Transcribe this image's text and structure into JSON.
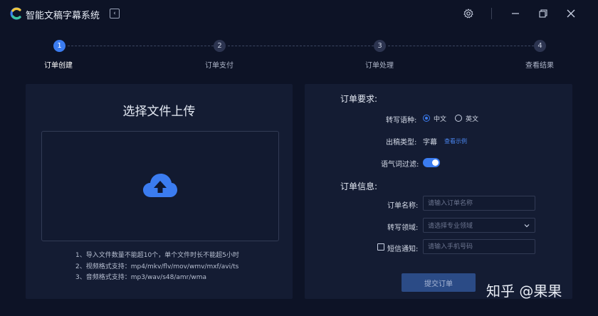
{
  "app": {
    "title": "智能文稿字幕系统",
    "collapse_icon": "‹"
  },
  "steps": [
    {
      "number": "1",
      "label": "订单创建",
      "active": true
    },
    {
      "number": "2",
      "label": "订单支付",
      "active": false
    },
    {
      "number": "3",
      "label": "订单处理",
      "active": false
    },
    {
      "number": "4",
      "label": "查看结果",
      "active": false
    }
  ],
  "upload": {
    "title": "选择文件上传",
    "notes": [
      "1、导入文件数量不能超10个，单个文件时长不能超5小时",
      "2、视频格式支持：mp4/mkv/flv/mov/wmv/mxf/avi/ts",
      "3、音频格式支持：mp3/wav/s48/amr/wma"
    ]
  },
  "requirements": {
    "section_title": "订单要求:",
    "language_label": "转写语种:",
    "language_options": [
      "中文",
      "英文"
    ],
    "output_type_label": "出稿类型:",
    "output_type_value": "字幕",
    "view_example_link": "查看示例",
    "filter_label": "语气词过滤:",
    "filter_on": true
  },
  "info": {
    "section_title": "订单信息:",
    "name_label": "订单名称:",
    "name_placeholder": "请输入订单名称",
    "domain_label": "转写领域:",
    "domain_placeholder": "请选择专业领域",
    "sms_label": "短信通知:",
    "sms_placeholder": "请输入手机号码",
    "submit_label": "提交订单"
  },
  "watermark": "知乎 @果果",
  "colors": {
    "background": "#0d1326",
    "panel": "#141c33",
    "accent": "#3b7cf0"
  }
}
